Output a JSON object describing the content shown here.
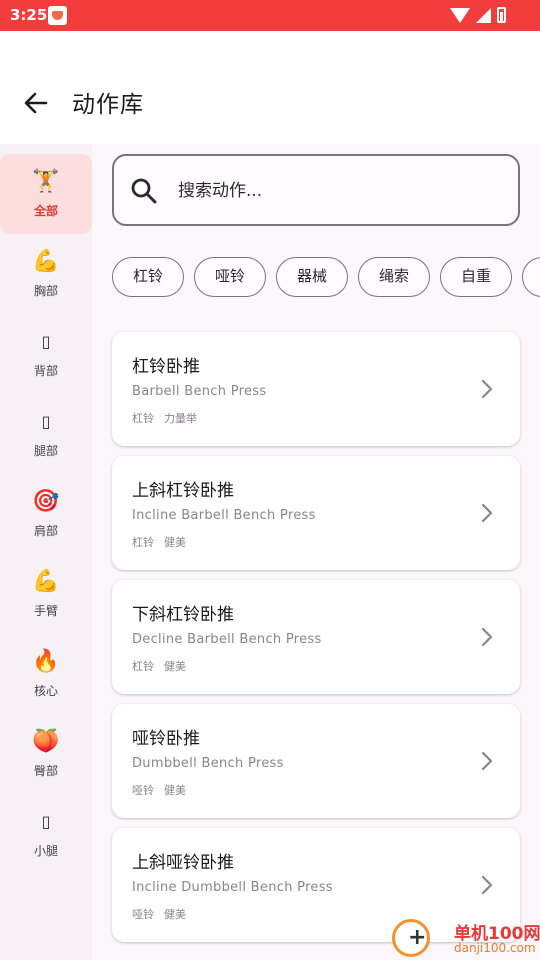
{
  "status_bar": {
    "time": "3:25"
  },
  "header": {
    "title": "动作库"
  },
  "sidebar": {
    "items": [
      {
        "label": "全部",
        "emoji": "🏋️",
        "icon": "weightlifter-icon",
        "active": true
      },
      {
        "label": "胸部",
        "emoji": "💪",
        "icon": "biceps-icon"
      },
      {
        "label": "背部",
        "emoji": "▯",
        "icon": "missing-glyph-icon"
      },
      {
        "label": "腿部",
        "emoji": "▯",
        "icon": "missing-glyph-icon"
      },
      {
        "label": "肩部",
        "emoji": "🎯",
        "icon": "target-icon"
      },
      {
        "label": "手臂",
        "emoji": "💪",
        "icon": "biceps-icon"
      },
      {
        "label": "核心",
        "emoji": "🔥",
        "icon": "fire-icon"
      },
      {
        "label": "臀部",
        "emoji": "🍑",
        "icon": "peach-icon"
      },
      {
        "label": "小腿",
        "emoji": "▯",
        "icon": "missing-glyph-icon"
      }
    ]
  },
  "search": {
    "placeholder": "搜索动作..."
  },
  "filters": [
    "杠铃",
    "哑铃",
    "器械",
    "绳索",
    "自重",
    ""
  ],
  "exercises": [
    {
      "name": "杠铃卧推",
      "english": "Barbell Bench Press",
      "equipment": "杠铃",
      "category": "力量举"
    },
    {
      "name": "上斜杠铃卧推",
      "english": "Incline Barbell Bench Press",
      "equipment": "杠铃",
      "category": "健美"
    },
    {
      "name": "下斜杠铃卧推",
      "english": "Decline Barbell Bench Press",
      "equipment": "杠铃",
      "category": "健美"
    },
    {
      "name": "哑铃卧推",
      "english": "Dumbbell Bench Press",
      "equipment": "哑铃",
      "category": "健美"
    },
    {
      "name": "上斜哑铃卧推",
      "english": "Incline Dumbbell Bench Press",
      "equipment": "哑铃",
      "category": "健美"
    }
  ],
  "watermark": {
    "text": "单机100网",
    "url": "danji100.com"
  },
  "colors": {
    "status_bar": "#f33d3d",
    "accent": "#e53935",
    "active_bg": "#fcdede",
    "sidebar_bg": "#f7f1f5"
  }
}
